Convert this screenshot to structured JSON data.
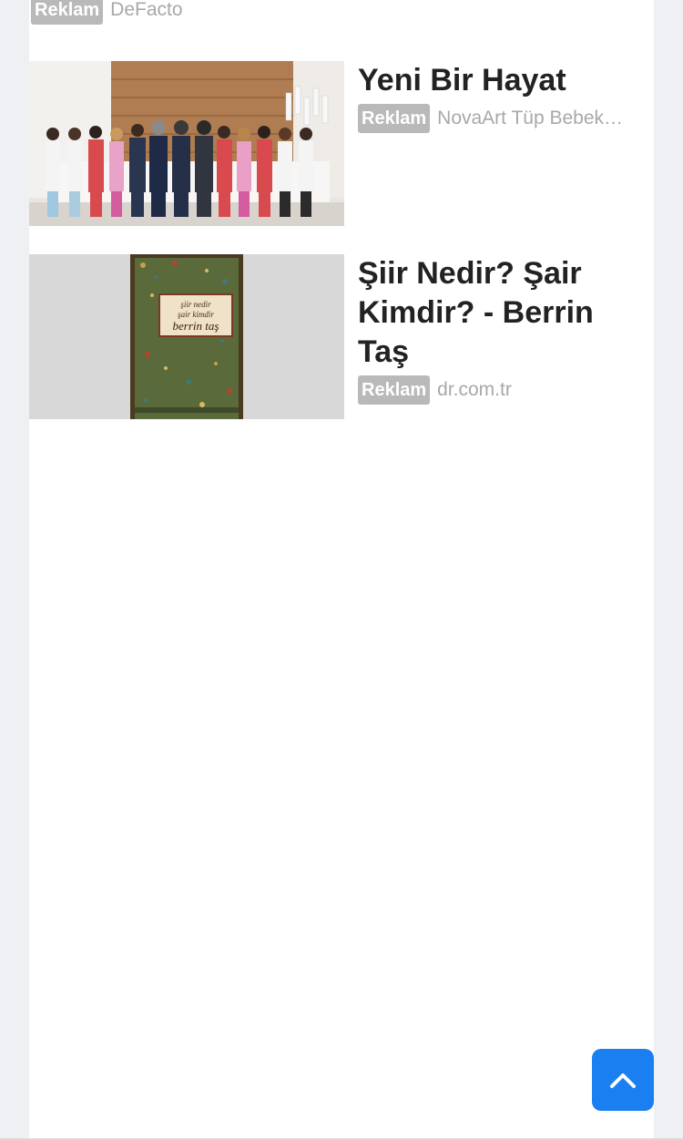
{
  "ads": {
    "partial": {
      "badge": "Reklam",
      "source": "DeFacto"
    },
    "items": [
      {
        "title": "Yeni Bir Hayat",
        "badge": "Reklam",
        "source": "NovaArt Tüp Bebek…"
      },
      {
        "title": "Şiir Nedir? Şair Kimdir? - Berrin Taş",
        "badge": "Reklam",
        "source": "dr.com.tr"
      }
    ]
  },
  "book_cover": {
    "line1": "şiir nedir",
    "line2": "şair kimdir",
    "line3": "berrin taş"
  },
  "scroll_top": {
    "icon": "chevron-up-icon"
  },
  "colors": {
    "accent": "#1a7ff0",
    "badge": "#b9b9b9",
    "title": "#222222",
    "source": "#a8a8a8"
  }
}
